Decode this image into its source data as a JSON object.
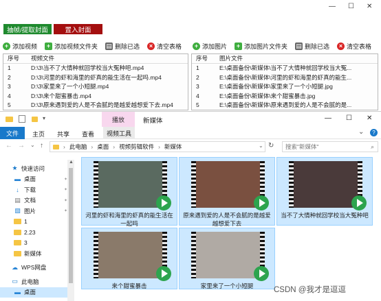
{
  "window_controls": {
    "minimize": "—",
    "maximize": "☐",
    "close": "✕"
  },
  "top_buttons": {
    "extract_cover": "抽帧/提取封面",
    "import_cover": "置入封面"
  },
  "left_toolbar": [
    {
      "label": "添加视频",
      "icon": "plus",
      "color": "#3fae3f"
    },
    {
      "label": "添加视频文件夹",
      "icon": "folder",
      "color": "#3fae3f"
    },
    {
      "label": "删除已选",
      "icon": "delete",
      "color": "#666"
    },
    {
      "label": "清空表格",
      "icon": "clear",
      "color": "#d92626"
    }
  ],
  "right_toolbar": [
    {
      "label": "添加图片",
      "icon": "plus",
      "color": "#3fae3f"
    },
    {
      "label": "添加图片文件夹",
      "icon": "folder",
      "color": "#3fae3f"
    },
    {
      "label": "删除已选",
      "icon": "delete",
      "color": "#666"
    },
    {
      "label": "清空表格",
      "icon": "clear",
      "color": "#d92626"
    }
  ],
  "video_table": {
    "headers": [
      "序号",
      "视频文件"
    ],
    "rows": [
      [
        "1",
        "D:\\3\\当不了大情种就回学校当大冤种吧.mp4"
      ],
      [
        "2",
        "D:\\3\\河里的虾和海里的虾真的能生活在一起吗.mp4"
      ],
      [
        "3",
        "D:\\3\\家里来了一个小短腿.mp4"
      ],
      [
        "4",
        "D:\\3\\来个甜蜜暴击.mp4"
      ],
      [
        "5",
        "D:\\3\\原来遇到爱的人是不会腻的是越爱越想爱下去.mp4"
      ]
    ]
  },
  "image_table": {
    "headers": [
      "序号",
      "图片文件"
    ],
    "rows": [
      [
        "1",
        "E:\\桌面备份\\新媒体\\当不了大情种就回学校当大冤..."
      ],
      [
        "2",
        "E:\\桌面备份\\新媒体\\河里的虾和海里的虾真的能生..."
      ],
      [
        "3",
        "E:\\桌面备份\\新媒体\\家里来了一个小短腿.jpg"
      ],
      [
        "4",
        "E:\\桌面备份\\新媒体\\来个甜蜜暴击.jpg"
      ],
      [
        "5",
        "E:\\桌面备份\\新媒体\\原来遇到爱的人是不会腻的是..."
      ]
    ]
  },
  "explorer": {
    "title": "新媒体",
    "context_tab": "播放",
    "ribbon_tabs": [
      "文件",
      "主页",
      "共享",
      "查看",
      "视频工具"
    ],
    "window_controls": {
      "minimize": "—",
      "maximize": "☐",
      "close": "✕",
      "chevron": "⌄",
      "help": "?"
    },
    "breadcrumb": [
      "此电脑",
      "桌面",
      "视频剪辑软件",
      "新媒体"
    ],
    "search_placeholder": "搜索\"新媒体\"",
    "nav": [
      {
        "label": "快速访问",
        "icon": "star-icon",
        "indent": 0,
        "pin": false
      },
      {
        "label": "桌面",
        "icon": "desktop-icon",
        "indent": 1,
        "pin": true
      },
      {
        "label": "下载",
        "icon": "download-icon",
        "indent": 1,
        "pin": true
      },
      {
        "label": "文档",
        "icon": "document-icon",
        "indent": 1,
        "pin": true
      },
      {
        "label": "图片",
        "icon": "picture-icon",
        "indent": 1,
        "pin": true
      },
      {
        "label": "1",
        "icon": "folder-icon",
        "indent": 1,
        "pin": false
      },
      {
        "label": "2.23",
        "icon": "folder-icon",
        "indent": 1,
        "pin": false
      },
      {
        "label": "3",
        "icon": "folder-icon",
        "indent": 1,
        "pin": false
      },
      {
        "label": "新媒体",
        "icon": "folder-icon",
        "indent": 1,
        "pin": false
      },
      {
        "label": "WPS网盘",
        "icon": "cloud-icon",
        "indent": 0,
        "pin": false
      },
      {
        "label": "此电脑",
        "icon": "computer-icon",
        "indent": 0,
        "pin": false
      },
      {
        "label": "桌面",
        "icon": "desktop-icon",
        "indent": 1,
        "pin": false
      }
    ],
    "files": [
      {
        "caption": "河里的虾和海里的虾真的能生活在一起吗",
        "thumb": "#5a6a60"
      },
      {
        "caption": "原来遇到爱的人是不会腻的是越爱越想爱下去",
        "thumb": "#7a5040"
      },
      {
        "caption": "当不了大情种就回学校当大冤种吧",
        "thumb": "#4a3a3a"
      },
      {
        "caption": "来个甜蜜暴击",
        "thumb": "#8a7a6a"
      },
      {
        "caption": "家里来了一个小短腿",
        "thumb": "#b0aaa4"
      }
    ]
  },
  "watermark": "CSDN @我才是逗逗"
}
